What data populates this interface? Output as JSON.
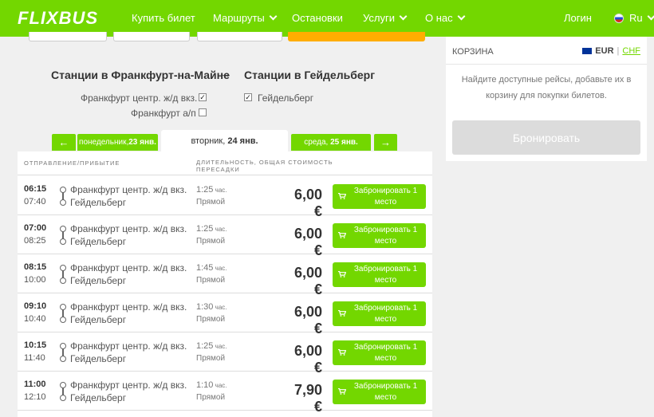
{
  "header": {
    "logo": "FLIXBUS",
    "nav": [
      {
        "label": "Купить билет",
        "dropdown": false
      },
      {
        "label": "Маршруты",
        "dropdown": true
      },
      {
        "label": "Остановки",
        "dropdown": false
      },
      {
        "label": "Услуги",
        "dropdown": true
      },
      {
        "label": "О нас",
        "dropdown": true
      }
    ],
    "login": "Логин",
    "language": "Ru",
    "brand_color": "#73d700"
  },
  "route": {
    "from_title": "Станции в Франкфурт-на-Майне",
    "arrow": "→",
    "to_title": "Станции в Гейдельберг",
    "from_stations": [
      {
        "name": "Франкфурт центр. ж/д вкз.",
        "checked": true
      },
      {
        "name": "Франкфурт а/п",
        "checked": false
      }
    ],
    "to_stations": [
      {
        "name": "Гейдельберг",
        "checked": true
      }
    ]
  },
  "dates": {
    "prev_arrow": "←",
    "next_arrow": "→",
    "prev_day": "понедельник, ",
    "prev_date": "23 янв.",
    "current_day": "вторник, ",
    "current_date": "24 янв.",
    "next_day": "среда, ",
    "next_date": "25 янв."
  },
  "table": {
    "col_departure": "ОТПРАВЛЕНИЕ/ПРИБЫТИЕ",
    "col_duration_line1": "ДЛИТЕЛЬНОСТЬ, ОБЩАЯ СТОИМОСТЬ",
    "col_duration_line2": "ПЕРЕСАДКИ",
    "rows": [
      {
        "dep": "06:15",
        "arr": "07:40",
        "from": "Франкфурт центр. ж/д вкз.",
        "to": "Гейдельберг",
        "dur": "1:25",
        "dur_unit": " час.",
        "transfer": "Прямой",
        "price": "6,00 €",
        "book": "Забронировать 1 место"
      },
      {
        "dep": "07:00",
        "arr": "08:25",
        "from": "Франкфурт центр. ж/д вкз.",
        "to": "Гейдельберг",
        "dur": "1:25",
        "dur_unit": " час.",
        "transfer": "Прямой",
        "price": "6,00 €",
        "book": "Забронировать 1 место"
      },
      {
        "dep": "08:15",
        "arr": "10:00",
        "from": "Франкфурт центр. ж/д вкз.",
        "to": "Гейдельберг",
        "dur": "1:45",
        "dur_unit": " час.",
        "transfer": "Прямой",
        "price": "6,00 €",
        "book": "Забронировать 1 место"
      },
      {
        "dep": "09:10",
        "arr": "10:40",
        "from": "Франкфурт центр. ж/д вкз.",
        "to": "Гейдельберг",
        "dur": "1:30",
        "dur_unit": " час.",
        "transfer": "Прямой",
        "price": "6,00 €",
        "book": "Забронировать 1 место"
      },
      {
        "dep": "10:15",
        "arr": "11:40",
        "from": "Франкфурт центр. ж/д вкз.",
        "to": "Гейдельберг",
        "dur": "1:25",
        "dur_unit": " час.",
        "transfer": "Прямой",
        "price": "6,00 €",
        "book": "Забронировать 1 место"
      },
      {
        "dep": "11:00",
        "arr": "12:10",
        "from": "Франкфурт центр. ж/д вкз.",
        "to": "Гейдельберг",
        "dur": "1:10",
        "dur_unit": " час.",
        "transfer": "Прямой",
        "price": "7,90 €",
        "book": "Забронировать 1 место"
      }
    ]
  },
  "cart": {
    "title": "КОРЗИНА",
    "currency_active": "EUR",
    "currency_sep": "|",
    "currency_other": "CHF",
    "empty_text": "Найдите доступные рейсы, добавьте их в корзину для покупки билетов.",
    "book_button": "Бронировать"
  }
}
